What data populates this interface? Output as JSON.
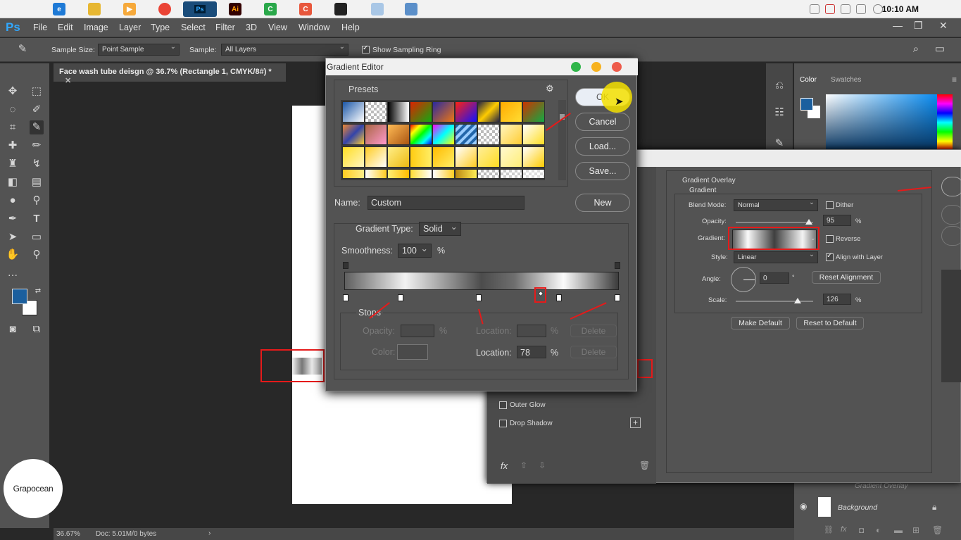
{
  "taskbar": {
    "clock": "10:10 AM"
  },
  "menubar": {
    "logo": "Ps",
    "items": [
      "File",
      "Edit",
      "Image",
      "Layer",
      "Type",
      "Select",
      "Filter",
      "3D",
      "View",
      "Window",
      "Help"
    ]
  },
  "options": {
    "sample_size_label": "Sample Size:",
    "sample_size_value": "Point Sample",
    "sample_label": "Sample:",
    "sample_value": "All Layers",
    "sampling_ring_label": "Show Sampling Ring"
  },
  "document": {
    "tab_title": "Face wash tube deisgn @ 36.7% (Rectangle 1, CMYK/8#) *",
    "zoom": "36.67%",
    "doc_info": "Doc: 5.01M/0 bytes"
  },
  "color_panel": {
    "tab_color": "Color",
    "tab_swatches": "Swatches",
    "fg": "#1b5f9e",
    "bg": "#ffffff"
  },
  "layer_style": {
    "section": "Gradient Overlay",
    "subsection": "Gradient",
    "blend_mode_label": "Blend Mode:",
    "blend_mode_value": "Normal",
    "dither_label": "Dither",
    "opacity_label": "Opacity:",
    "opacity_value": "95",
    "gradient_label": "Gradient:",
    "reverse_label": "Reverse",
    "style_label": "Style:",
    "style_value": "Linear",
    "align_label": "Align with Layer",
    "angle_label": "Angle:",
    "angle_value": "0",
    "reset_alignment": "Reset Alignment",
    "scale_label": "Scale:",
    "scale_value": "126",
    "percent": "%",
    "make_default": "Make Default",
    "reset_default": "Reset to Default",
    "outer_glow": "Outer Glow",
    "drop_shadow": "Drop Shadow",
    "fx": "fx"
  },
  "layers": {
    "gradient_overlay": "Gradient Overlay",
    "background": "Background"
  },
  "gradient_editor": {
    "title": "Gradient Editor",
    "presets_label": "Presets",
    "ok": "OK",
    "cancel": "Cancel",
    "load": "Load...",
    "save": "Save...",
    "name_label": "Name:",
    "name_value": "Custom",
    "new": "New",
    "type_label": "Gradient Type:",
    "type_value": "Solid",
    "smoothness_label": "Smoothness:",
    "smoothness_value": "100",
    "percent": "%",
    "stops_label": "Stops",
    "opacity_label": "Opacity:",
    "location_label": "Location:",
    "delete": "Delete",
    "color_label": "Color:",
    "location_value": "78"
  },
  "watermark": "Grapocean"
}
